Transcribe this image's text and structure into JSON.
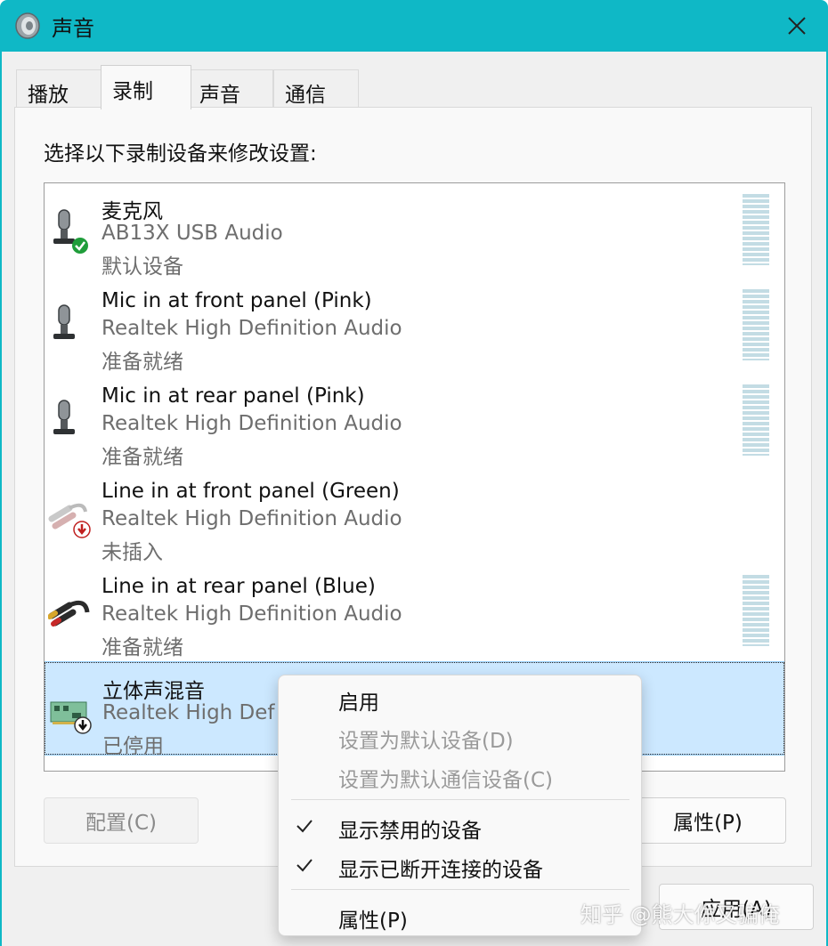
{
  "window": {
    "title": "声音"
  },
  "tabs": [
    {
      "label": "播放"
    },
    {
      "label": "录制"
    },
    {
      "label": "声音"
    },
    {
      "label": "通信"
    }
  ],
  "prompt": "选择以下录制设备来修改设置:",
  "devices": [
    {
      "name": "麦克风",
      "driver": "AB13X USB Audio",
      "status": "默认设备",
      "icon": "microphone-icon",
      "badge": "green-check"
    },
    {
      "name": "Mic in at front panel (Pink)",
      "driver": "Realtek High Definition Audio",
      "status": "准备就绪",
      "icon": "microphone-icon"
    },
    {
      "name": "Mic in at rear panel (Pink)",
      "driver": "Realtek High Definition Audio",
      "status": "准备就绪",
      "icon": "microphone-icon"
    },
    {
      "name": "Line in at front panel (Green)",
      "driver": "Realtek High Definition Audio",
      "status": "未插入",
      "icon": "line-in-cable-icon",
      "badge": "red-down-arrow"
    },
    {
      "name": "Line in at rear panel (Blue)",
      "driver": "Realtek High Definition Audio",
      "status": "准备就绪",
      "icon": "line-in-cable-icon"
    },
    {
      "name": "立体声混音",
      "driver": "Realtek High Def",
      "status": "已停用",
      "icon": "sound-card-icon",
      "badge": "black-down-arrow"
    }
  ],
  "buttons": {
    "configure": "配置(C)",
    "properties": "属性(P)",
    "apply": "应用(A)"
  },
  "context_menu": [
    {
      "label": "启用",
      "enabled": true,
      "checked": false
    },
    {
      "label": "设置为默认设备(D)",
      "enabled": false,
      "checked": false
    },
    {
      "label": "设置为默认通信设备(C)",
      "enabled": false,
      "checked": false
    },
    {
      "label": "显示禁用的设备",
      "enabled": true,
      "checked": true
    },
    {
      "label": "显示已断开连接的设备",
      "enabled": true,
      "checked": true
    },
    {
      "label": "属性(P)",
      "enabled": true,
      "checked": false
    }
  ],
  "watermark": "知乎 @熊大你又骗俺",
  "colors": {
    "title_bar": "#0fb8c6",
    "selection": "#cce8ff",
    "meter": "#c3dce4"
  }
}
